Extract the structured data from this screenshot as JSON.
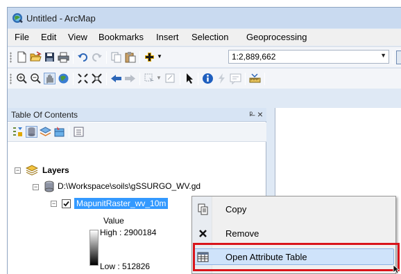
{
  "window": {
    "title": "Untitled - ArcMap"
  },
  "menu": [
    "File",
    "Edit",
    "View",
    "Bookmarks",
    "Insert",
    "Selection",
    "Geoprocessing"
  ],
  "toolbar": {
    "scale_value": "1:2,889,662"
  },
  "toc": {
    "title": "Table Of Contents",
    "root_label": "Layers",
    "workspace_label": "D:\\Workspace\\soils\\gSSURGO_WV.gd",
    "layer_label": "MapunitRaster_wv_10m",
    "legend_value_label": "Value",
    "legend_high": "High : 2900184",
    "legend_low": "Low : 512826"
  },
  "context_menu": {
    "items": [
      {
        "label": "Copy",
        "icon": "copy-icon"
      },
      {
        "label": "Remove",
        "icon": "remove-icon"
      },
      {
        "label": "Open Attribute Table",
        "icon": "table-icon"
      }
    ]
  },
  "colors": {
    "highlight_outline": "#d9141a",
    "selection_blue": "#3399ff"
  }
}
